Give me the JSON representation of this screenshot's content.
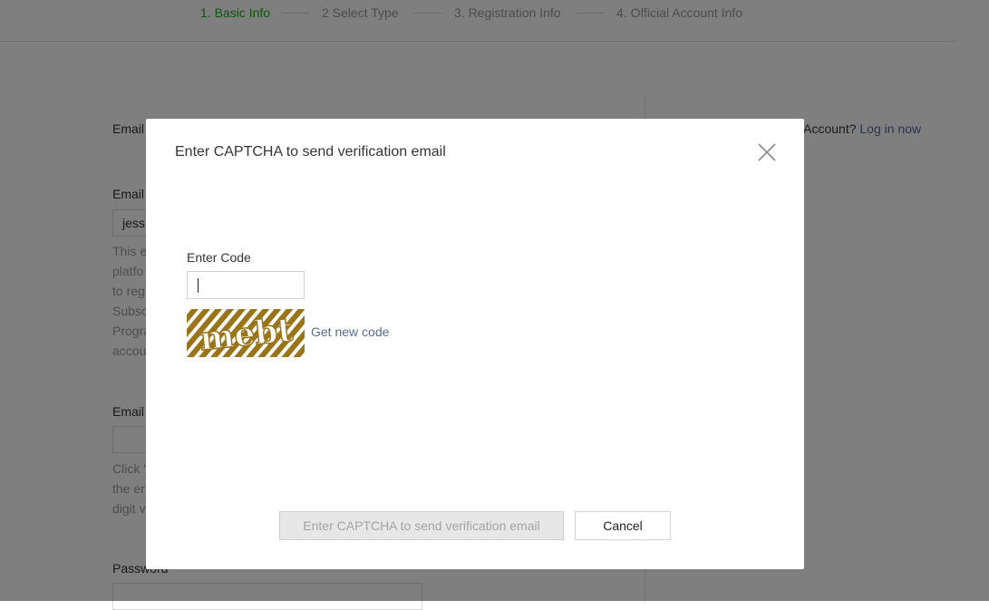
{
  "steps": [
    {
      "label": "1. Basic Info",
      "active": true
    },
    {
      "label": "2 Select Type",
      "active": false
    },
    {
      "label": "3. Registration Info",
      "active": false
    },
    {
      "label": "4. Official Account Info",
      "active": false
    }
  ],
  "form": {
    "email_label_partial": "Email",
    "email_field_label_partial": "Email",
    "email_value_partial": "jess",
    "email_tip_lines": [
      "This e",
      "platfo",
      "to reg",
      "Subsc",
      "Progra",
      "accou"
    ],
    "email_code_label_partial": "Email",
    "email_code_tip_lines": [
      "Click '",
      "the er",
      "digit v"
    ],
    "password_label": "Password"
  },
  "login": {
    "prefix": "ficial Account?",
    "link": "Log in now"
  },
  "dialog": {
    "title": "Enter CAPTCHA to send verification email",
    "code_label": "Enter Code",
    "code_value": "",
    "captcha_text": "mebt",
    "new_code_link": "Get new code",
    "submit_label": "Enter CAPTCHA to send verification email",
    "submit_disabled": true,
    "cancel_label": "Cancel"
  },
  "colors": {
    "active_step": "#1aad19",
    "link": "#576b95",
    "overlay": "rgba(0,0,0,0.5)",
    "captcha_brown": "#9a7418"
  },
  "icons": {
    "close": "close-icon"
  }
}
